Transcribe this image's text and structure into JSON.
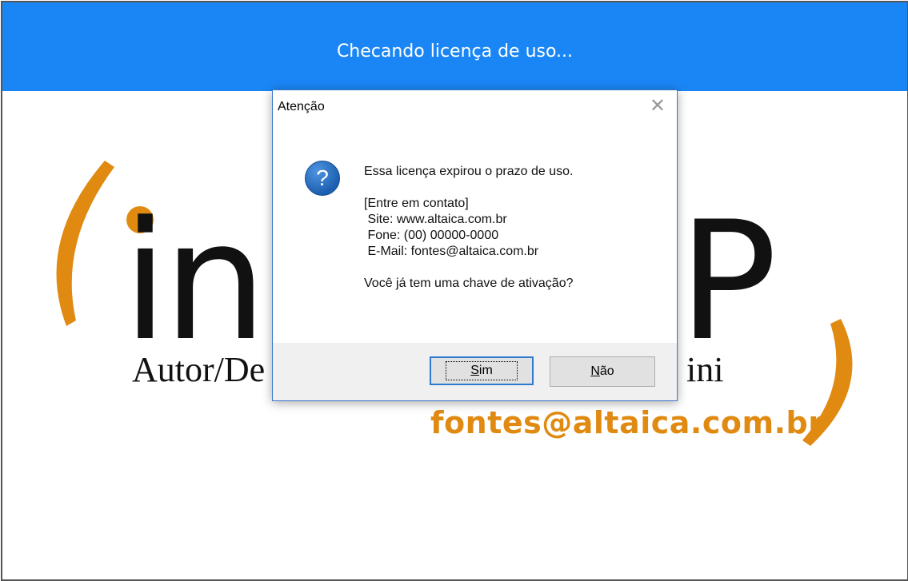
{
  "header": {
    "title": "Checando licença de uso..."
  },
  "splash": {
    "logo_left": "in",
    "logo_right": "P",
    "autor_left": "Autor/De",
    "autor_right": "ini",
    "email": "fontes@altaica.com.br",
    "accent_color": "#e08a12"
  },
  "dialog": {
    "title": "Atenção",
    "close_icon": "close-icon",
    "icon": "question-icon",
    "message_lines": [
      "Essa licença expirou o prazo de uso.",
      "",
      "[Entre em contato]",
      " Site: www.altaica.com.br",
      " Fone: (00) 00000-0000",
      " E-Mail: fontes@altaica.com.br",
      "",
      "Você já tem uma chave de ativação?"
    ],
    "buttons": {
      "yes": {
        "mnemonic": "S",
        "rest": "im"
      },
      "no": {
        "mnemonic": "N",
        "rest": "ão"
      }
    }
  },
  "colors": {
    "header_bg": "#1a86f5",
    "dialog_border": "#3a78c9"
  }
}
